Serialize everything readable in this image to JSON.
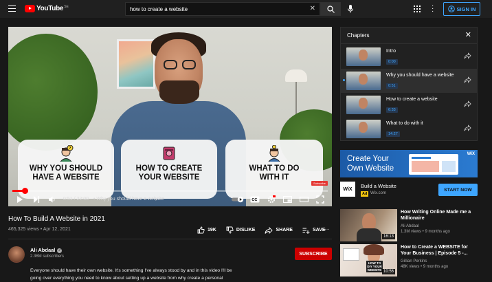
{
  "header": {
    "logo_text": "YouTube",
    "logo_region": "SE",
    "search_value": "how to create a website",
    "signin_label": "SIGN IN",
    "brand_red": "#ff0000",
    "accent_blue": "#3ea6ff"
  },
  "player": {
    "cards": [
      {
        "line1": "WHY YOU SHOULD",
        "line2": "HAVE A WEBSITE"
      },
      {
        "line1": "HOW TO CREATE",
        "line2": "YOUR WEBSITE"
      },
      {
        "line1": "WHAT TO DO",
        "line2": "WITH IT"
      }
    ],
    "watermark": "Subscribe",
    "time_display": "0:51 / 22:00",
    "chapter_display": "• Why you should have a website",
    "progress": 0.04,
    "icons": [
      "play-icon",
      "next-icon",
      "volume-icon",
      "autoplay-toggle-icon",
      "captions-icon",
      "settings-icon",
      "miniplayer-icon",
      "theater-icon",
      "fullscreen-icon"
    ]
  },
  "video": {
    "title": "How To Build A Website in 2021",
    "meta": "465,325 views • Apr 12, 2021",
    "like_count": "19K",
    "dislike_label": "DISLIKE",
    "share_label": "SHARE",
    "save_label": "SAVE"
  },
  "channel": {
    "name": "Ali Abdaal",
    "subscribers": "2.36M subscribers",
    "subscribe_label": "SUBSCRIBE",
    "description": "Everyone should have their own website. It's something I've always stood by and in this video I'll be going over everything you need to know about setting up a website from why create a personal"
  },
  "chapters": {
    "title": "Chapters",
    "items": [
      {
        "name": "Intro",
        "time": "0:00",
        "active": false
      },
      {
        "name": "Why you should have a website",
        "time": "0:51",
        "active": true
      },
      {
        "name": "How to create a website",
        "time": "6:33",
        "active": false
      },
      {
        "name": "What to do with it",
        "time": "14:27",
        "active": false
      }
    ]
  },
  "ad": {
    "banner_line1": "Create Your",
    "banner_line2": "Own Website",
    "banner_brand": "WiX",
    "logo": "WiX",
    "title": "Build a Website",
    "tag": "Ad",
    "domain": "Wix.com",
    "cta": "START NOW"
  },
  "recommendations": [
    {
      "title_line1": "How Writing Online Made me a",
      "title_line2": "Millionaire",
      "channel": "Ali Abdaal",
      "views": "1.3M views • 9 months ago",
      "duration": "16:13"
    },
    {
      "title_line1": "How to Create a WEBSITE for",
      "title_line2": "Your Business | Episode 5 -...",
      "channel": "Gillian Perkins",
      "views": "48K views • 9 months ago",
      "duration": "10:56",
      "thumb_text": "HOW TO DIY YOUR WEBSITE"
    }
  ]
}
